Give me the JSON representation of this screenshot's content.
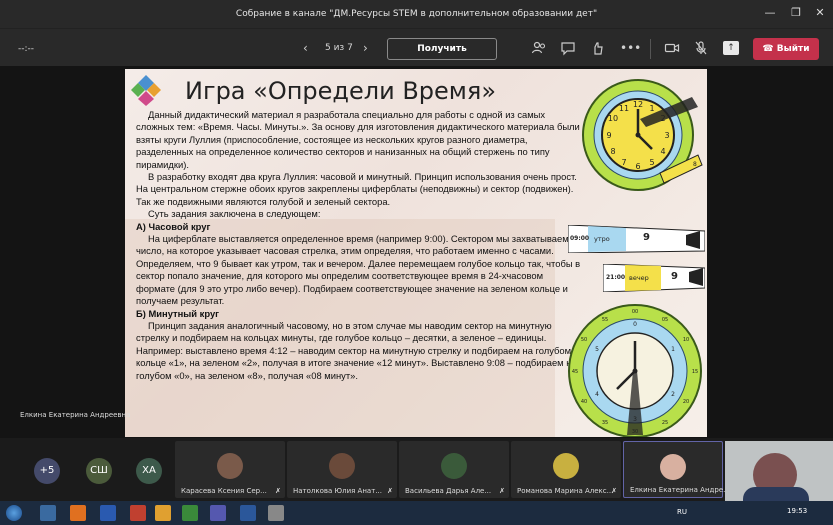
{
  "window": {
    "title": "Собрание в канале \"ДМ.Ресурсы STEM в дополнительном образовании дет\"",
    "minimize": "—",
    "maximize": "❐",
    "close": "✕"
  },
  "toolbar": {
    "timer": "--:--",
    "pager": "5 из 7",
    "control_label": "Получить управление",
    "leave_label": "Выйти"
  },
  "presenter_name": "Елкина Екатерина Андреевна",
  "slide": {
    "title": "Игра «Определи Время»",
    "paragraphs": [
      "Данный дидактический материал я разработала специально для работы с одной из самых сложных тем: «Время. Часы. Минуты.». За основу для изготовления дидактического материала были взяты круги Луллия (приспособление, состоящее из нескольких кругов разного диаметра, разделенных на определенное количество секторов и нанизанных на общий стержень по типу пирамидки).",
      "В разработку входят два круга Луллия: часовой и минутный. Принцип использования очень прост. На центральном стержне обоих кругов закреплены циферблаты (неподвижны) и сектор (подвижен). Так же подвижными являются голубой и зеленый сектора.",
      "Суть задания заключена в следующем:"
    ],
    "heading_a": "А) Часовой круг",
    "paragraph_a": "На циферблате выставляется определенное время (например 9:00). Сектором мы захватываем число, на которое указывает часовая стрелка, этим определяя, что работаем именно с часами. Определяем, что 9 бывает как утром, так и вечером. Далее перемещаем голубое кольцо так, чтобы в сектор попало значение, для которого мы определим соответствующее время в 24-хчасовом формате (для 9 это утро либо вечер). Подбираем соответствующее значение на зеленом кольце и получаем результат.",
    "heading_b": "Б) Минутный круг",
    "paragraph_b": "Принцип задания аналогичный часовому, но в этом случае мы наводим сектор на минутную стрелку и подбираем на кольцах минуты, где голубое кольцо – десятки, а зеленое – единицы. Например: выставлено время 4:12 – наводим сектор на минутную стрелку и подбираем на голубом кольце «1», на зеленом «2», получая в итоге значение «12 минут». Выставлено 9:08 – подбираем на голубом «0», на зеленом «8», получая «08 минут».",
    "strip1": {
      "time": "09:00",
      "label": "утро",
      "num": "9"
    },
    "strip2": {
      "time": "21:00",
      "label": "вечер",
      "num": "9"
    },
    "clock_small_num": "8",
    "minute_ring": [
      "00",
      "05",
      "10",
      "15",
      "20",
      "25",
      "30",
      "35",
      "40",
      "45",
      "50",
      "55"
    ],
    "minute_ring_digits": [
      "0",
      "1",
      "2",
      "3",
      "4",
      "5"
    ]
  },
  "participants": {
    "more": "+5",
    "initials": [
      "СШ",
      "ХА"
    ],
    "tiles": [
      {
        "name": "Карасева Ксения Сер..."
      },
      {
        "name": "Натолкова Юлия Анат..."
      },
      {
        "name": "Васильева Дарья Але..."
      },
      {
        "name": "Романова Марина Алекс..."
      },
      {
        "name": "Елкина Екатерина Андре..."
      }
    ]
  },
  "taskbar": {
    "lang": "RU",
    "time": "19:53"
  },
  "colors": {
    "leave": "#c4314b",
    "clock_green": "#b8e04a",
    "clock_yellow": "#f4e04a",
    "ring_blue": "#a9d8f0",
    "bubble_more": "#444a6a",
    "bubble_sh": "#4b5b3b",
    "bubble_ha": "#3d5a4b"
  }
}
